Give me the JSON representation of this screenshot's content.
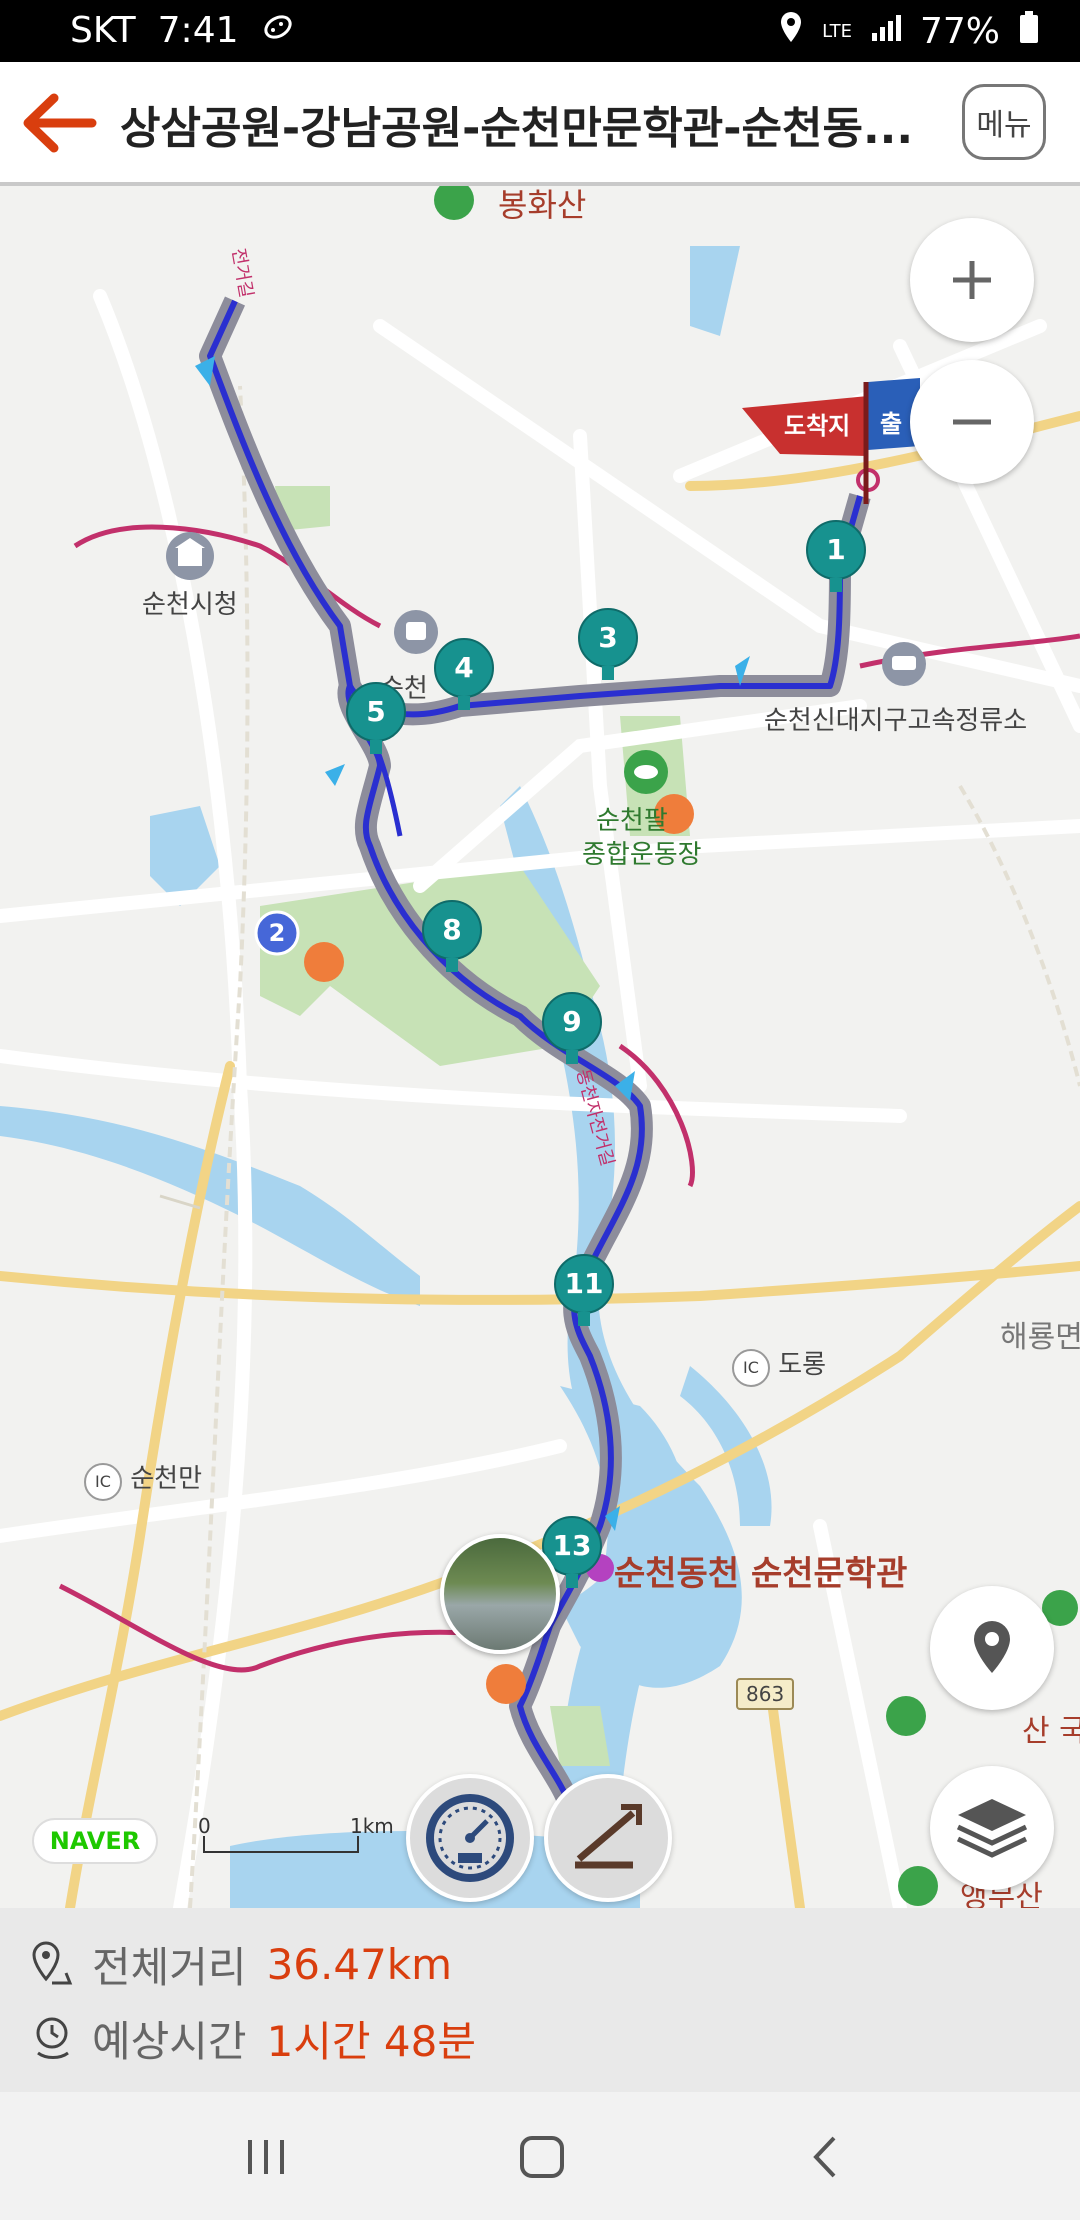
{
  "status_bar": {
    "carrier": "SKT",
    "time": "7:41",
    "battery": "77%",
    "network": "LTE"
  },
  "header": {
    "title": "상삼공원-강남공원-순천만문학관-순천동...",
    "menu_label": "메뉴"
  },
  "map": {
    "labels": {
      "bonghwasan": "봉화산",
      "city_hall": "순천시청",
      "suncheon": "순천",
      "terminal": "순천신대지구고속정류소",
      "stadium_a": "순천팔",
      "stadium_b": "종합운동장",
      "dorong": "도롱",
      "suncheonman": "순천만",
      "museum": "순천동천 순천문학관",
      "haeryong": "해룡면",
      "road863": "863",
      "aengmusan": "앵무산",
      "san": "산 국",
      "ic": "IC",
      "destination_flag": "도착지",
      "start_flag": "출",
      "road_vertical_a": "동천자전거길",
      "road_vertical_b": "전거길"
    },
    "markers": [
      "1",
      "3",
      "4",
      "5",
      "8",
      "9",
      "11",
      "13"
    ],
    "blue_marker": "2",
    "scale": {
      "start": "0",
      "end": "1km"
    },
    "brand": "NAVER",
    "icons": [
      "zoom-in-icon",
      "zoom-out-icon",
      "location-pin-icon",
      "layers-icon",
      "speedometer-icon",
      "elevation-icon"
    ]
  },
  "info": {
    "distance_label": "전체거리",
    "distance_value": "36.47km",
    "time_label": "예상시간",
    "time_value": "1시간 48분"
  },
  "colors": {
    "accent": "#d93e0e",
    "route": "#2a2fd0",
    "marker": "#17928f",
    "park": "#c7e2b6",
    "water": "#a8d4ef"
  }
}
